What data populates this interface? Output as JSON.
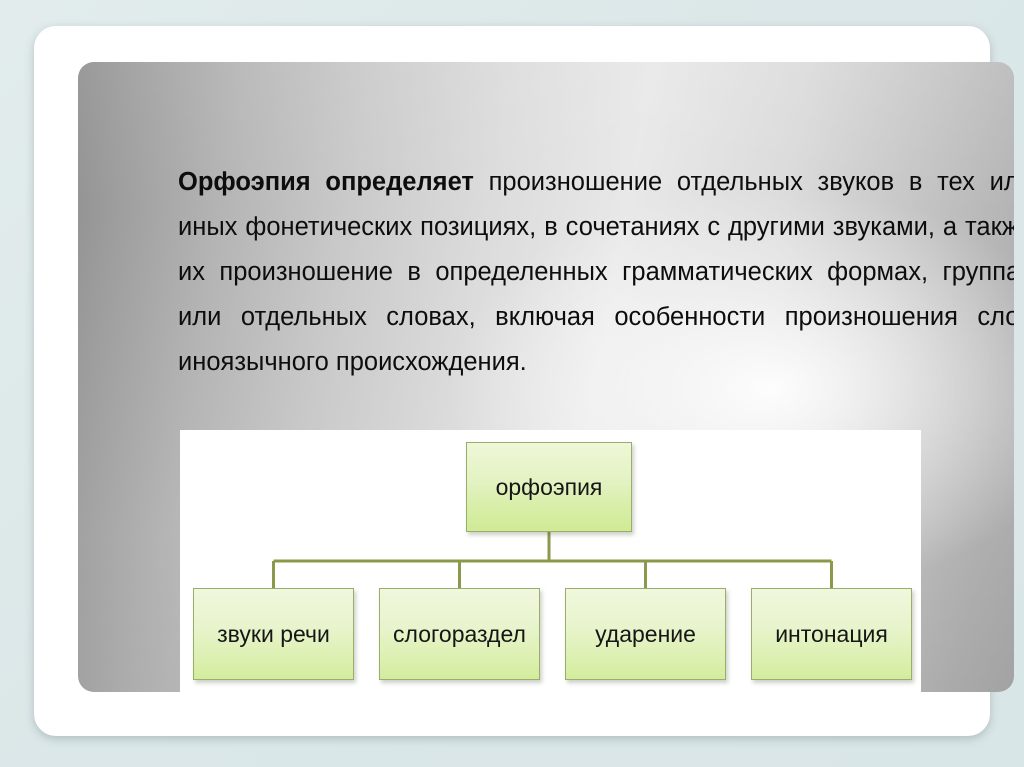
{
  "slide": {
    "paragraph": {
      "lead": "Орфоэпия определяет",
      "rest": " произношение отдельных звуков в тех или иных фонетических позициях, в сочетаниях с другими звуками, а также их произношение в определенных грамматических формах, группах или отдельных словах, включая особенности произношения слов иноязычного происхождения."
    },
    "diagram": {
      "root": {
        "label": "орфоэпия"
      },
      "leaves": [
        {
          "label": "звуки речи"
        },
        {
          "label": "слогораздел"
        },
        {
          "label": "ударение"
        },
        {
          "label": "интонация"
        }
      ],
      "connector_color": "#8a9a4a",
      "node_fill_top": "#f0f7dd",
      "node_fill_bottom": "#d3ec9d",
      "node_border": "#9aad6d"
    },
    "colors": {
      "outer_background": "#dde8e9",
      "card_background": "#ffffff",
      "panel_gradient_dark": "#8e8e8e",
      "panel_gradient_light": "#e8e8e8",
      "diagram_panel_background": "#ffffff",
      "text": "#0d0d0d"
    }
  }
}
